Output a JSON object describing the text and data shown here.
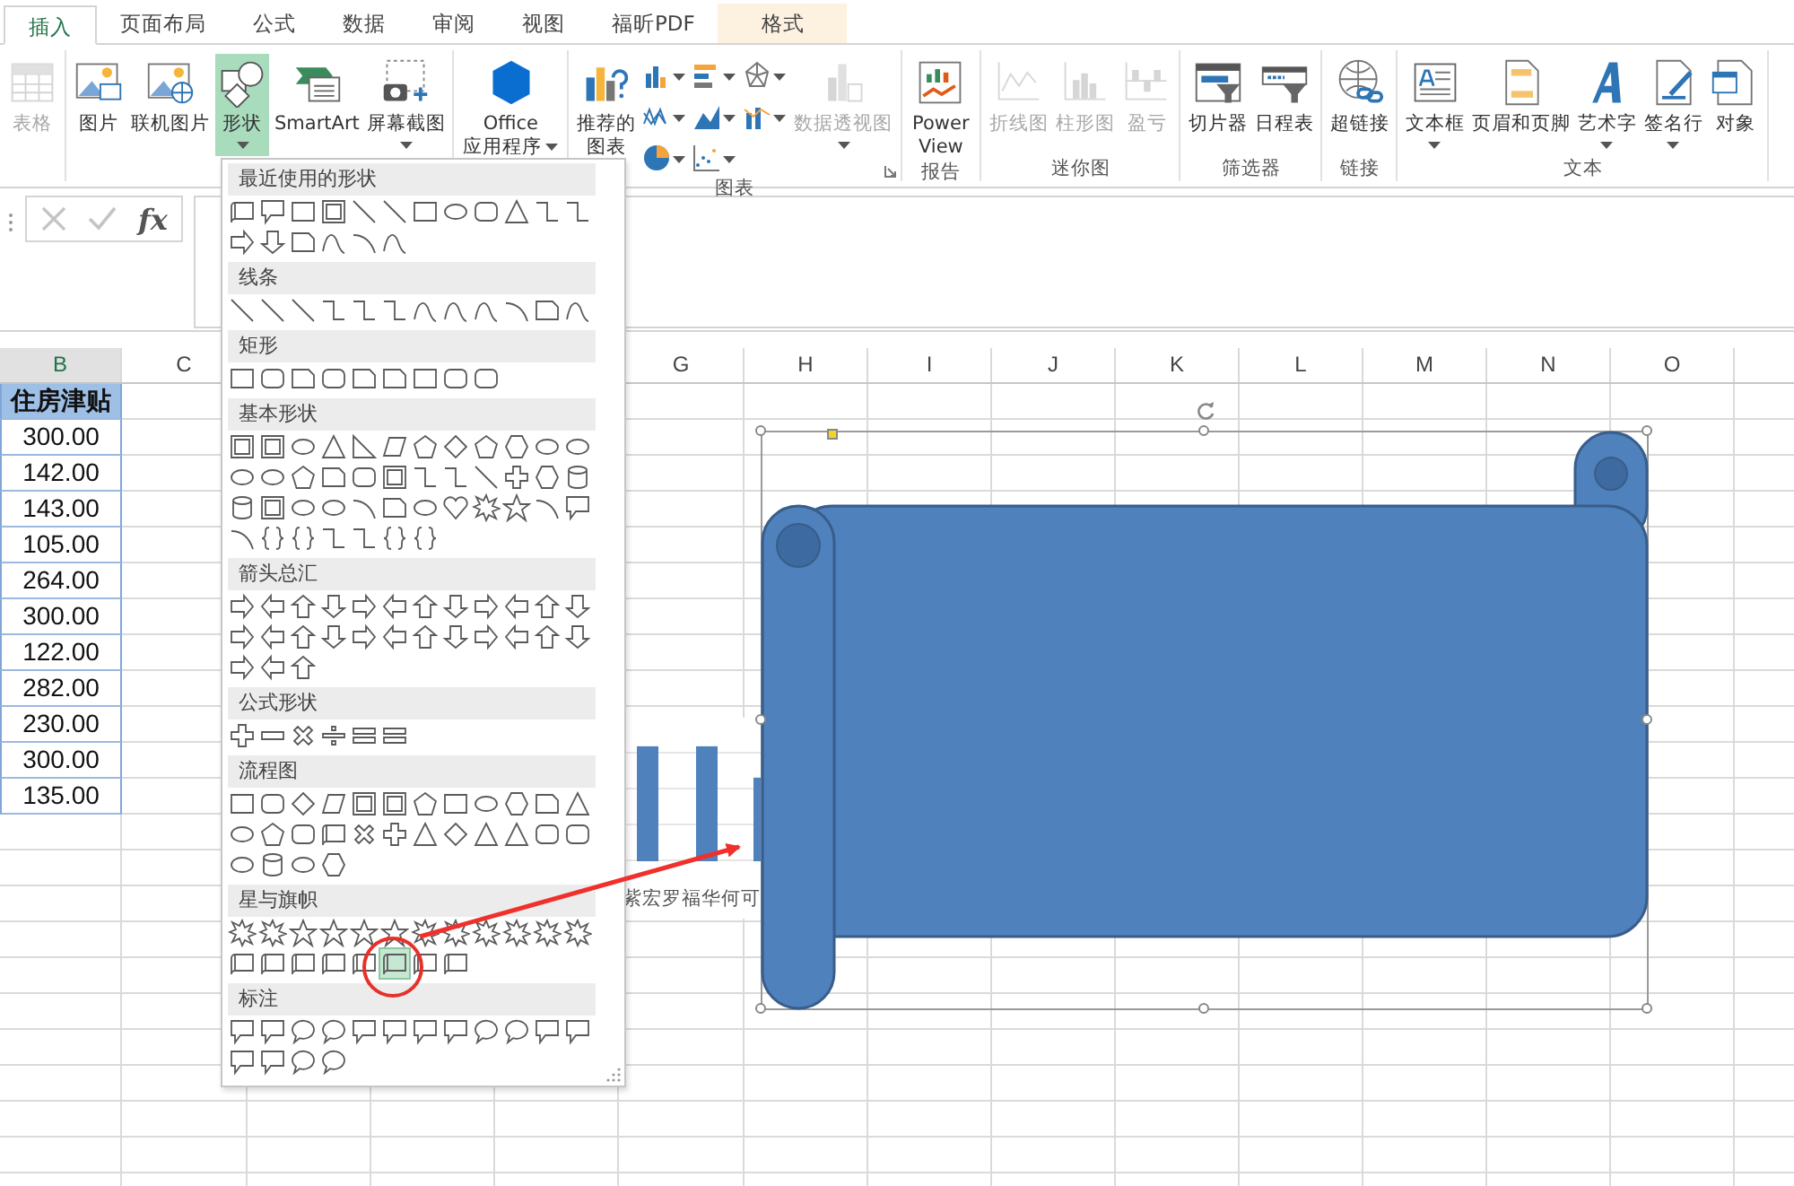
{
  "tabs": [
    {
      "label": "插入",
      "selected": true,
      "contextual": false
    },
    {
      "label": "页面布局",
      "selected": false,
      "contextual": false
    },
    {
      "label": "公式",
      "selected": false,
      "contextual": false
    },
    {
      "label": "数据",
      "selected": false,
      "contextual": false
    },
    {
      "label": "审阅",
      "selected": false,
      "contextual": false
    },
    {
      "label": "视图",
      "selected": false,
      "contextual": false
    },
    {
      "label": "福昕PDF",
      "selected": false,
      "contextual": false
    },
    {
      "label": "格式",
      "selected": false,
      "contextual": true
    }
  ],
  "ribbon": {
    "groups": [
      {
        "buttons": [
          {
            "kind": "table",
            "label": "表格",
            "disabled": true,
            "selected": false,
            "dropdown": false
          }
        ]
      },
      {
        "buttons": [
          {
            "kind": "picture",
            "label": "图片",
            "disabled": false,
            "selected": false,
            "dropdown": false
          },
          {
            "kind": "online-picture",
            "label": "联机图片",
            "disabled": false,
            "selected": false,
            "dropdown": false
          },
          {
            "kind": "shapes",
            "label": "形状",
            "disabled": false,
            "selected": true,
            "dropdown": true
          },
          {
            "kind": "smartart",
            "label": "SmartArt",
            "disabled": false,
            "selected": false,
            "dropdown": false
          },
          {
            "kind": "screenshot",
            "label": "屏幕截图",
            "disabled": false,
            "selected": false,
            "dropdown": true
          }
        ]
      },
      {
        "buttons": [
          {
            "kind": "office",
            "label": "Office 应用程序",
            "disabled": false,
            "selected": false,
            "dropdown": true
          }
        ]
      },
      {
        "label": "图表",
        "launcher": true,
        "buttons": [
          {
            "kind": "recommended",
            "label": "推荐的图表",
            "disabled": false,
            "selected": false,
            "dropdown": false
          },
          {
            "kind": "chart-gallery"
          },
          {
            "kind": "pivotchart",
            "label": "数据透视图",
            "disabled": true,
            "selected": false,
            "dropdown": true
          }
        ]
      },
      {
        "label": "报告",
        "buttons": [
          {
            "kind": "powerview",
            "label": "Power View",
            "disabled": false,
            "selected": false,
            "dropdown": false
          }
        ]
      },
      {
        "label": "迷你图",
        "buttons": [
          {
            "kind": "spark-line",
            "label": "折线图",
            "disabled": true,
            "selected": false,
            "dropdown": false
          },
          {
            "kind": "spark-column",
            "label": "柱形图",
            "disabled": true,
            "selected": false,
            "dropdown": false
          },
          {
            "kind": "spark-winloss",
            "label": "盈亏",
            "disabled": true,
            "selected": false,
            "dropdown": false
          }
        ]
      },
      {
        "label": "筛选器",
        "buttons": [
          {
            "kind": "slicer",
            "label": "切片器",
            "disabled": false,
            "selected": false,
            "dropdown": false
          },
          {
            "kind": "timeline",
            "label": "日程表",
            "disabled": false,
            "selected": false,
            "dropdown": false
          }
        ]
      },
      {
        "label": "链接",
        "buttons": [
          {
            "kind": "hyperlink",
            "label": "超链接",
            "disabled": false,
            "selected": false,
            "dropdown": false
          }
        ]
      },
      {
        "label": "文本",
        "buttons": [
          {
            "kind": "textbox",
            "label": "文本框",
            "disabled": false,
            "selected": false,
            "dropdown": true
          },
          {
            "kind": "header",
            "label": "页眉和页脚",
            "disabled": false,
            "selected": false,
            "dropdown": false
          },
          {
            "kind": "wordart",
            "label": "艺术字",
            "disabled": false,
            "selected": false,
            "dropdown": true
          },
          {
            "kind": "signature",
            "label": "签名行",
            "disabled": false,
            "selected": false,
            "dropdown": true
          },
          {
            "kind": "object",
            "label": "对象",
            "disabled": false,
            "selected": false,
            "dropdown": false
          }
        ]
      }
    ]
  },
  "formula_bar": {
    "function_label": "fx"
  },
  "sheet": {
    "columns": [
      {
        "label": "B"
      },
      {
        "label": "C"
      },
      {
        "label": "G"
      },
      {
        "label": "H"
      },
      {
        "label": "I"
      },
      {
        "label": "J"
      },
      {
        "label": "K"
      },
      {
        "label": "L"
      },
      {
        "label": "M"
      },
      {
        "label": "N"
      },
      {
        "label": "O"
      }
    ],
    "header": "住房津贴",
    "values": [
      "300.00",
      "142.00",
      "143.00",
      "105.00",
      "264.00",
      "300.00",
      "122.00",
      "282.00",
      "230.00",
      "300.00",
      "135.00"
    ]
  },
  "chart": {
    "category_label": "紫宏罗福华何可"
  },
  "drawing": {
    "kind": "scroll",
    "selected": true
  },
  "shapes_menu": {
    "sections": [
      {
        "title": "最近使用的形状",
        "kind": "recent",
        "shapes": [
          {
            "selected": false
          },
          {
            "selected": false
          },
          {
            "selected": false
          },
          {
            "selected": false
          },
          {
            "selected": false
          },
          {
            "selected": false
          },
          {
            "selected": false
          },
          {
            "selected": false
          },
          {
            "selected": false
          },
          {
            "selected": false
          },
          {
            "selected": false
          },
          {
            "selected": false
          },
          {
            "selected": false
          },
          {
            "selected": false
          },
          {
            "selected": false
          },
          {
            "selected": false
          },
          {
            "selected": false
          },
          {
            "selected": false
          }
        ]
      },
      {
        "title": "线条",
        "kind": "lines",
        "shapes": [
          {
            "selected": false
          },
          {
            "selected": false
          },
          {
            "selected": false
          },
          {
            "selected": false
          },
          {
            "selected": false
          },
          {
            "selected": false
          },
          {
            "selected": false
          },
          {
            "selected": false
          },
          {
            "selected": false
          },
          {
            "selected": false
          },
          {
            "selected": false
          },
          {
            "selected": false
          }
        ]
      },
      {
        "title": "矩形",
        "kind": "rectangles",
        "shapes": [
          {
            "selected": false
          },
          {
            "selected": false
          },
          {
            "selected": false
          },
          {
            "selected": false
          },
          {
            "selected": false
          },
          {
            "selected": false
          },
          {
            "selected": false
          },
          {
            "selected": false
          },
          {
            "selected": false
          }
        ]
      },
      {
        "title": "基本形状",
        "kind": "basic",
        "shapes": [
          {
            "selected": false
          },
          {
            "selected": false
          },
          {
            "selected": false
          },
          {
            "selected": false
          },
          {
            "selected": false
          },
          {
            "selected": false
          },
          {
            "selected": false
          },
          {
            "selected": false
          },
          {
            "selected": false
          },
          {
            "selected": false
          },
          {
            "selected": false
          },
          {
            "selected": false
          },
          {
            "selected": false
          },
          {
            "selected": false
          },
          {
            "selected": false
          },
          {
            "selected": false
          },
          {
            "selected": false
          },
          {
            "selected": false
          },
          {
            "selected": false
          },
          {
            "selected": false
          },
          {
            "selected": false
          },
          {
            "selected": false
          },
          {
            "selected": false
          },
          {
            "selected": false
          },
          {
            "selected": false
          },
          {
            "selected": false
          },
          {
            "selected": false
          },
          {
            "selected": false
          },
          {
            "selected": false
          },
          {
            "selected": false
          },
          {
            "selected": false
          },
          {
            "selected": false
          },
          {
            "selected": false
          },
          {
            "selected": false
          },
          {
            "selected": false
          },
          {
            "selected": false
          },
          {
            "selected": false
          },
          {
            "selected": false
          },
          {
            "selected": false
          },
          {
            "selected": false
          },
          {
            "selected": false
          },
          {
            "selected": false
          },
          {
            "selected": false
          }
        ]
      },
      {
        "title": "箭头总汇",
        "kind": "arrows",
        "shapes": [
          {
            "selected": false
          },
          {
            "selected": false
          },
          {
            "selected": false
          },
          {
            "selected": false
          },
          {
            "selected": false
          },
          {
            "selected": false
          },
          {
            "selected": false
          },
          {
            "selected": false
          },
          {
            "selected": false
          },
          {
            "selected": false
          },
          {
            "selected": false
          },
          {
            "selected": false
          },
          {
            "selected": false
          },
          {
            "selected": false
          },
          {
            "selected": false
          },
          {
            "selected": false
          },
          {
            "selected": false
          },
          {
            "selected": false
          },
          {
            "selected": false
          },
          {
            "selected": false
          },
          {
            "selected": false
          },
          {
            "selected": false
          },
          {
            "selected": false
          },
          {
            "selected": false
          },
          {
            "selected": false
          },
          {
            "selected": false
          },
          {
            "selected": false
          }
        ]
      },
      {
        "title": "公式形状",
        "kind": "equation",
        "shapes": [
          {
            "selected": false
          },
          {
            "selected": false
          },
          {
            "selected": false
          },
          {
            "selected": false
          },
          {
            "selected": false
          },
          {
            "selected": false
          }
        ]
      },
      {
        "title": "流程图",
        "kind": "flowchart",
        "shapes": [
          {
            "selected": false
          },
          {
            "selected": false
          },
          {
            "selected": false
          },
          {
            "selected": false
          },
          {
            "selected": false
          },
          {
            "selected": false
          },
          {
            "selected": false
          },
          {
            "selected": false
          },
          {
            "selected": false
          },
          {
            "selected": false
          },
          {
            "selected": false
          },
          {
            "selected": false
          },
          {
            "selected": false
          },
          {
            "selected": false
          },
          {
            "selected": false
          },
          {
            "selected": false
          },
          {
            "selected": false
          },
          {
            "selected": false
          },
          {
            "selected": false
          },
          {
            "selected": false
          },
          {
            "selected": false
          },
          {
            "selected": false
          },
          {
            "selected": false
          },
          {
            "selected": false
          },
          {
            "selected": false
          },
          {
            "selected": false
          },
          {
            "selected": false
          },
          {
            "selected": false
          }
        ]
      },
      {
        "title": "星与旗帜",
        "kind": "stars",
        "shapes": [
          {
            "selected": false
          },
          {
            "selected": false
          },
          {
            "selected": false
          },
          {
            "selected": false
          },
          {
            "selected": false
          },
          {
            "selected": false
          },
          {
            "selected": false
          },
          {
            "selected": false
          },
          {
            "selected": false
          },
          {
            "selected": false
          },
          {
            "selected": false
          },
          {
            "selected": false
          },
          {
            "selected": false
          },
          {
            "selected": false
          },
          {
            "selected": false
          },
          {
            "selected": false
          },
          {
            "selected": false
          },
          {
            "selected": true
          },
          {
            "selected": false
          },
          {
            "selected": false
          }
        ]
      },
      {
        "title": "标注",
        "kind": "callouts",
        "shapes": [
          {
            "selected": false
          },
          {
            "selected": false
          },
          {
            "selected": false
          },
          {
            "selected": false
          },
          {
            "selected": false
          },
          {
            "selected": false
          },
          {
            "selected": false
          },
          {
            "selected": false
          },
          {
            "selected": false
          },
          {
            "selected": false
          },
          {
            "selected": false
          },
          {
            "selected": false
          },
          {
            "selected": false
          },
          {
            "selected": false
          },
          {
            "selected": false
          },
          {
            "selected": false
          }
        ]
      }
    ]
  }
}
